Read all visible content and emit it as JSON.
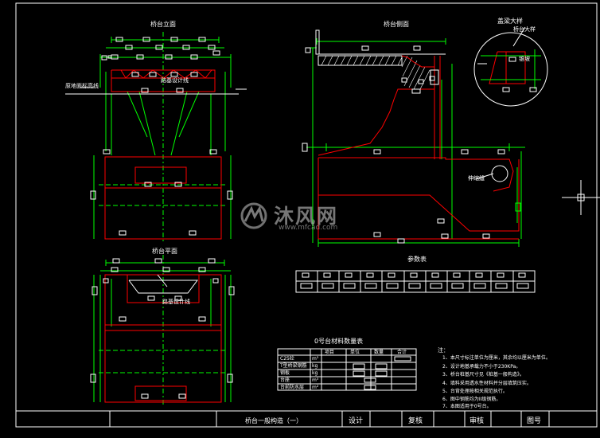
{
  "views": {
    "front_elevation_title": "桥台立面",
    "side_elevation_title": "桥台侧面",
    "plan_title": "桥台平面",
    "detail_title": "盖梁大样"
  },
  "labels": {
    "ground_line": "原地面标高线",
    "design_line_top": "路基设计线",
    "design_line_plan": "路基设计线",
    "detail_note": "桥台大样",
    "joint_note": "伸缩缝",
    "side_note": "锥坡"
  },
  "params_table": {
    "title": "参数表"
  },
  "materials_table": {
    "title": "0号台材料数量表",
    "headers": [
      "项目",
      "单位",
      "数量",
      "合计"
    ],
    "rows": [
      {
        "item": "C25砼",
        "unit": "m³"
      },
      {
        "item": "T型桥梁钢筋",
        "unit": "kg"
      },
      {
        "item": "钢板",
        "unit": "kg"
      },
      {
        "item": "台座",
        "unit": "m³"
      },
      {
        "item": "台前防水层",
        "unit": "m²"
      }
    ]
  },
  "notes": {
    "heading": "注：",
    "items": [
      "1、本尺寸标注单位为厘米，其余均以厘米为单位。",
      "2、设计地基承载力不小于230KPa。",
      "3、桥台桩基尺寸见《桩基一般构造》。",
      "4、填料采用透水性材料并分层填筑压实。",
      "5、台背处理按相关规范执行。",
      "6、图中钢筋均为II级钢筋。",
      "7、本图适用于0号台。"
    ]
  },
  "title_block": {
    "drawing_title": "桥台一般构造（一）",
    "design": "设计",
    "review": "复核",
    "approve": "审核",
    "drawing_no": "图号"
  },
  "watermark": {
    "brand": "沐风网",
    "url": "www.mfcad.com"
  },
  "colors": {
    "background": "#000000",
    "outline": "#ff0000",
    "dimension": "#00ff00",
    "text": "#ffffff",
    "hatch": "#ffffff",
    "accent": "#ffff00"
  }
}
